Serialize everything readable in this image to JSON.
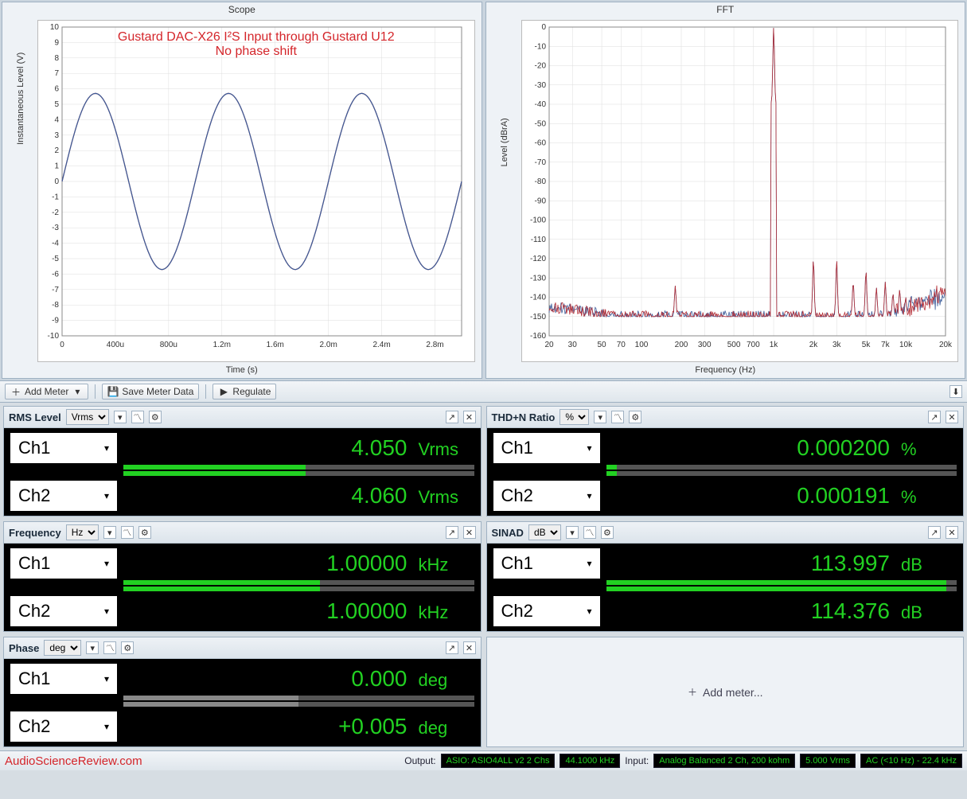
{
  "chart_data": [
    {
      "type": "line",
      "panel": "Scope",
      "xlabel": "Time (s)",
      "ylabel": "Instantaneous Level (V)",
      "xlim": [
        0,
        0.003
      ],
      "ylim": [
        -10,
        10
      ],
      "x_ticks": [
        "0",
        "400u",
        "800u",
        "1.2m",
        "1.6m",
        "2.0m",
        "2.4m",
        "2.8m"
      ],
      "y_ticks": [
        -10,
        -9,
        -8,
        -7,
        -6,
        -5,
        -4,
        -3,
        -2,
        -1,
        0,
        1,
        2,
        3,
        4,
        5,
        6,
        7,
        8,
        9,
        10
      ],
      "series": [
        {
          "name": "Ch1",
          "color": "#9a2b3a",
          "amplitude_v": 5.7,
          "frequency_hz": 1000,
          "phase_deg": 0
        },
        {
          "name": "Ch2",
          "color": "#3c5d9a",
          "amplitude_v": 5.7,
          "frequency_hz": 1000,
          "phase_deg": 0
        }
      ],
      "annotation": {
        "line1": "Gustard DAC-X26 I²S Input through Gustard U12",
        "line2": "No phase shift"
      }
    },
    {
      "type": "line",
      "panel": "FFT",
      "xlabel": "Frequency (Hz)",
      "ylabel": "Level (dBrA)",
      "xscale": "log",
      "xlim": [
        20,
        20000
      ],
      "ylim": [
        -160,
        0
      ],
      "x_ticks": [
        20,
        30,
        50,
        70,
        100,
        200,
        300,
        500,
        700,
        "1k",
        "2k",
        "3k",
        "5k",
        "7k",
        "10k",
        "20k"
      ],
      "y_ticks": [
        0,
        -10,
        -20,
        -30,
        -40,
        -50,
        -60,
        -70,
        -80,
        -90,
        -100,
        -110,
        -120,
        -130,
        -140,
        -150,
        -160
      ],
      "noise_floor_db": -150,
      "peaks": [
        {
          "hz": 60,
          "db": -148
        },
        {
          "hz": 180,
          "db": -134
        },
        {
          "hz": 1000,
          "db": 0
        },
        {
          "hz": 2000,
          "db": -120
        },
        {
          "hz": 3000,
          "db": -120
        },
        {
          "hz": 4000,
          "db": -132
        },
        {
          "hz": 5000,
          "db": -126
        },
        {
          "hz": 6000,
          "db": -135
        },
        {
          "hz": 7000,
          "db": -132
        },
        {
          "hz": 8000,
          "db": -138
        },
        {
          "hz": 9000,
          "db": -136
        },
        {
          "hz": 10000,
          "db": -140
        }
      ],
      "series_colors": {
        "Ch1": "#b42c34",
        "Ch2": "#3c5d9a"
      }
    }
  ],
  "toolbar": {
    "add_meter": "Add Meter",
    "save_meter_data": "Save Meter Data",
    "regulate": "Regulate"
  },
  "meters": {
    "rms": {
      "title": "RMS Level",
      "unit_sel": "Vrms",
      "ch1": {
        "label": "Ch1",
        "value": "4.050",
        "unit": "Vrms",
        "bar_pct": 52
      },
      "ch2": {
        "label": "Ch2",
        "value": "4.060",
        "unit": "Vrms",
        "bar_pct": 52
      }
    },
    "thdn": {
      "title": "THD+N Ratio",
      "unit_sel": "%",
      "ch1": {
        "label": "Ch1",
        "value": "0.000200",
        "unit": "%",
        "bar_pct": 3
      },
      "ch2": {
        "label": "Ch2",
        "value": "0.000191",
        "unit": "%",
        "bar_pct": 3
      }
    },
    "freq": {
      "title": "Frequency",
      "unit_sel": "Hz",
      "ch1": {
        "label": "Ch1",
        "value": "1.00000",
        "unit": "kHz",
        "bar_pct": 56
      },
      "ch2": {
        "label": "Ch2",
        "value": "1.00000",
        "unit": "kHz",
        "bar_pct": 56
      }
    },
    "sinad": {
      "title": "SINAD",
      "unit_sel": "dB",
      "ch1": {
        "label": "Ch1",
        "value": "113.997",
        "unit": "dB",
        "bar_pct": 97
      },
      "ch2": {
        "label": "Ch2",
        "value": "114.376",
        "unit": "dB",
        "bar_pct": 97
      }
    },
    "phase": {
      "title": "Phase",
      "unit_sel": "deg",
      "ch1": {
        "label": "Ch1",
        "value": "0.000",
        "unit": "deg",
        "bar_pct": 50,
        "grey": true
      },
      "ch2": {
        "label": "Ch2",
        "value": "+0.005",
        "unit": "deg",
        "bar_pct": 50,
        "grey": true
      }
    },
    "add_tile": "Add meter..."
  },
  "statusbar": {
    "watermark": "AudioScienceReview.com",
    "output_label": "Output:",
    "output_value": "ASIO: ASIO4ALL v2 2 Chs",
    "output_rate": "44.1000 kHz",
    "input_label": "Input:",
    "input_value": "Analog Balanced 2 Ch, 200 kohm",
    "input_range": "5.000 Vrms",
    "input_bw": "AC (<10 Hz) - 22.4 kHz"
  }
}
